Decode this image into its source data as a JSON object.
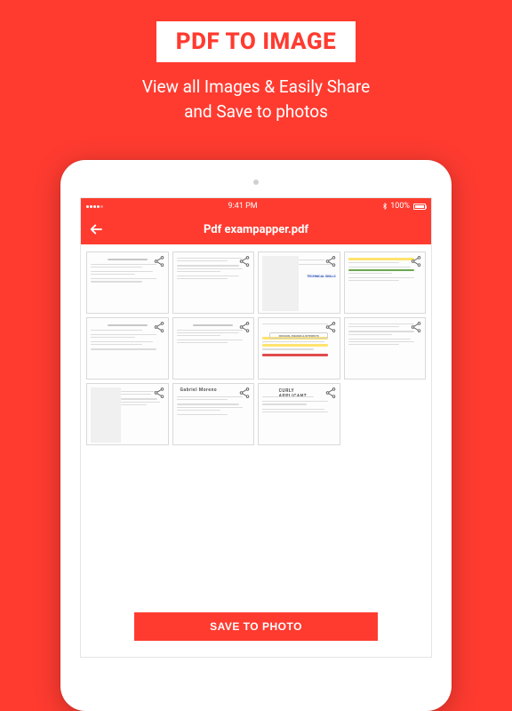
{
  "hero": {
    "badge": "PDF TO IMAGE",
    "line1": "View all Images & Easily Share",
    "line2": "and Save to photos"
  },
  "status": {
    "carrier_dots": 5,
    "time": "9:41 PM",
    "battery_pct": "100%"
  },
  "navbar": {
    "title": "Pdf exampapper.pdf"
  },
  "tech_label": "TECHNICAL SKILLS",
  "gabriel_name": "Gabriel Moreno",
  "curly_name": "CURLY APPLICANT",
  "pill_text": "PASSION, AWARDS & INTERESTS",
  "cta": {
    "label": "SAVE TO PHOTO"
  }
}
